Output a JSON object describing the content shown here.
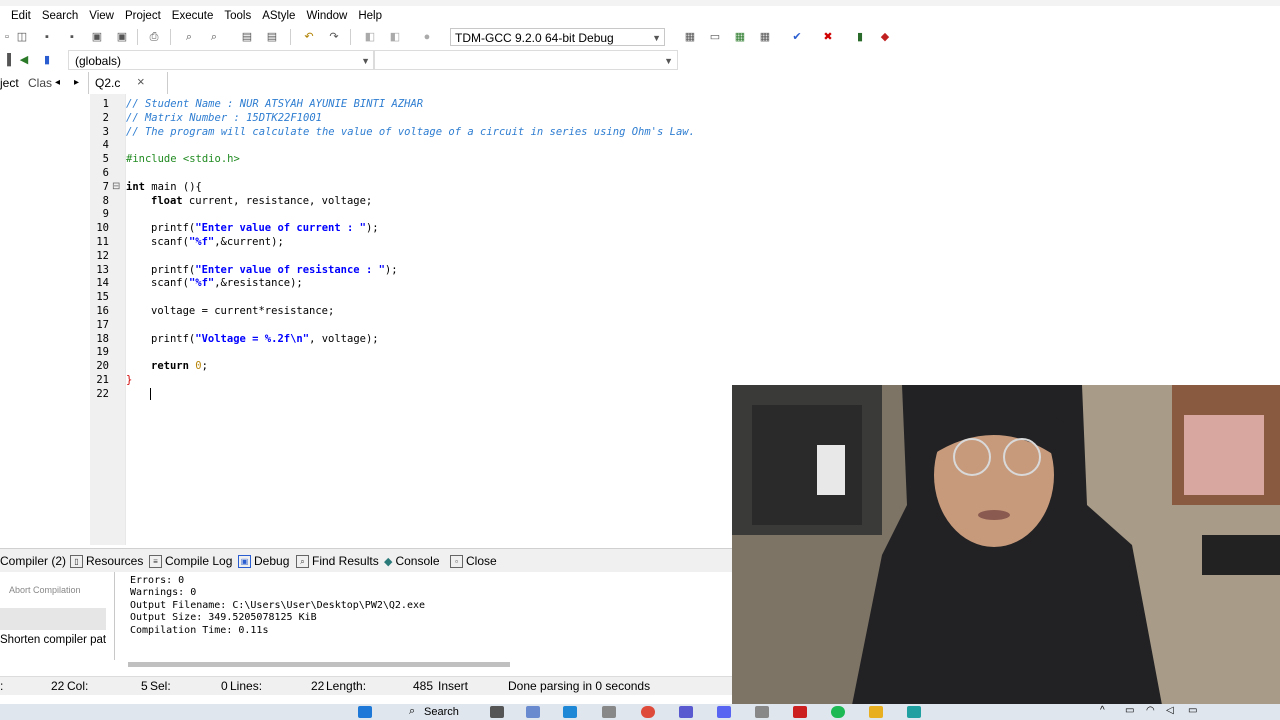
{
  "menu": [
    "Edit",
    "Search",
    "View",
    "Project",
    "Execute",
    "Tools",
    "AStyle",
    "Window",
    "Help"
  ],
  "toolbar": {
    "compiler": "TDM-GCC 9.2.0 64-bit Debug"
  },
  "scope": {
    "globals": "(globals)"
  },
  "panel_tabs": {
    "project": "ject",
    "classes": "Clas",
    "prev": "◂",
    "next": "▸"
  },
  "file_tab": {
    "name": "Q2.c",
    "close": "×"
  },
  "code": {
    "line_numbers": [
      "1",
      "2",
      "3",
      "4",
      "5",
      "6",
      "7",
      "8",
      "9",
      "10",
      "11",
      "12",
      "13",
      "14",
      "15",
      "16",
      "17",
      "18",
      "19",
      "20",
      "21",
      "22"
    ],
    "l1": "// Student Name : NUR ATSYAH AYUNIE BINTI AZHAR",
    "l2": "// Matrix Number : 15DTK22F1001",
    "l3": "// The program will calculate the value of voltage of a circuit in series using Ohm's Law.",
    "l5": "#include <stdio.h>",
    "l7_kw": "int",
    "l7_rest": " main (){",
    "l8_kw": "float",
    "l8_rest": " current, resistance, voltage;",
    "l10_fn": "printf(",
    "l10_str": "\"Enter value of current : \"",
    "l10_end": ");",
    "l11_fn": "scanf(",
    "l11_str": "\"%f\"",
    "l11_end": ",&current);",
    "l13_fn": "printf(",
    "l13_str": "\"Enter value of resistance : \"",
    "l13_end": ");",
    "l14_fn": "scanf(",
    "l14_str": "\"%f\"",
    "l14_end": ",&resistance);",
    "l16": "voltage = current*resistance;",
    "l18_fn": "printf(",
    "l18_str": "\"Voltage = %.2f\\n\"",
    "l18_end": ", voltage);",
    "l20_kw": "return",
    "l20_num": " 0",
    "l20_end": ";",
    "l21": "}",
    "fold": "⊟"
  },
  "bottom_tabs": {
    "compiler": "Compiler (2)",
    "resources": "Resources",
    "compile_log": "Compile Log",
    "debug": "Debug",
    "find_results": "Find Results",
    "console": "Console",
    "close": "Close"
  },
  "compile_panel": {
    "abort": "Abort Compilation",
    "shorten": "Shorten compiler pat"
  },
  "compile_log": [
    "Errors: 0",
    "Warnings: 0",
    "Output Filename: C:\\Users\\User\\Desktop\\PW2\\Q2.exe",
    "Output Size: 349.5205078125 KiB",
    "Compilation Time: 0.11s"
  ],
  "status": {
    "line": "22",
    "col_label": "Col:",
    "col": "5",
    "sel_label": "Sel:",
    "sel": "0",
    "lines_label": "Lines:",
    "lines": "22",
    "length_label": "Length:",
    "length": "485",
    "mode": "Insert",
    "message": "Done parsing in 0 seconds"
  },
  "taskbar": {
    "search": "Search"
  },
  "colors": {
    "current_line": "#ccf5ff",
    "comment": "#2e7dd1",
    "string": "#0000ff",
    "preprocessor": "#228b22"
  }
}
